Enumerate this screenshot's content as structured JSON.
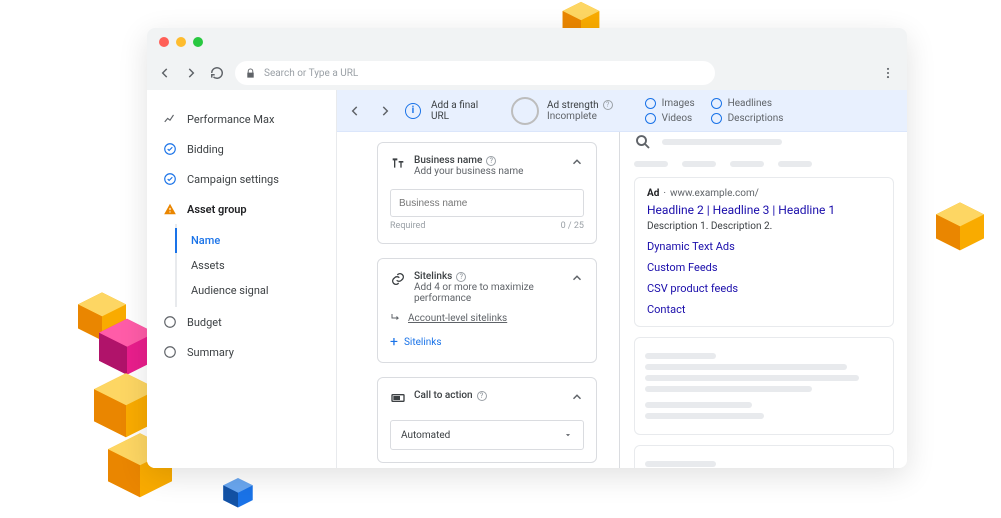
{
  "urlbar": {
    "placeholder": "Search or Type a URL"
  },
  "sidebar": {
    "items": [
      {
        "label": "Performance Max",
        "icon": "trend-icon"
      },
      {
        "label": "Bidding",
        "icon": "check-circle-icon"
      },
      {
        "label": "Campaign settings",
        "icon": "check-circle-icon"
      },
      {
        "label": "Asset group",
        "icon": "warning-icon"
      },
      {
        "label": "Budget",
        "icon": "radio-empty-icon"
      },
      {
        "label": "Summary",
        "icon": "radio-empty-icon"
      }
    ],
    "subitems": [
      "Name",
      "Assets",
      "Audience signal"
    ]
  },
  "topbar": {
    "final_url": "Add a final URL",
    "ad_strength_label": "Ad strength",
    "ad_strength_value": "Incomplete",
    "checks": [
      "Images",
      "Headlines",
      "Videos",
      "Descriptions"
    ]
  },
  "business_card": {
    "title": "Business name",
    "subtitle": "Add your business name",
    "placeholder": "Business name",
    "required": "Required",
    "counter": "0 / 25"
  },
  "sitelinks_card": {
    "title": "Sitelinks",
    "subtitle": "Add 4 or more to maximize performance",
    "account_link": "Account-level sitelinks",
    "add": "Sitelinks"
  },
  "cta_card": {
    "title": "Call to action",
    "value": "Automated"
  },
  "preview": {
    "ad_label": "Ad",
    "domain": "www.example.com/",
    "headline": "Headline 2 | Headline 3 | Headline 1",
    "description": "Description 1. Description 2.",
    "sitelinks": [
      "Dynamic Text Ads",
      "Custom Feeds",
      "CSV product feeds",
      "Contact"
    ]
  }
}
